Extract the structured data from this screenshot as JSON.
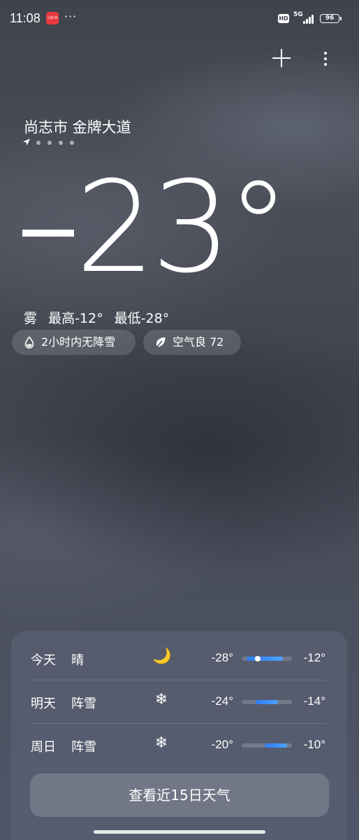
{
  "status_bar": {
    "time": "11:08",
    "app_badge_text": "小红书",
    "more": "···",
    "hd": "HD",
    "network": "5G",
    "battery": "96"
  },
  "location": {
    "name": "尚志市 金牌大道",
    "page_count": 5,
    "current_page": 1
  },
  "current": {
    "temperature": "23°",
    "temperature_value": -23,
    "condition": "雾",
    "high": "最高-12°",
    "low": "最低-28°"
  },
  "chips": {
    "precip": "2小时内无降雪",
    "air": "空气良 72"
  },
  "forecast": [
    {
      "day": "今天",
      "condition": "晴",
      "icon": "moon-icon",
      "glyph": "🌙",
      "low": "-28°",
      "high": "-12°",
      "low_v": -28,
      "high_v": -12,
      "current_v": -23
    },
    {
      "day": "明天",
      "condition": "阵雪",
      "icon": "snowflake-icon",
      "glyph": "❄",
      "low": "-24°",
      "high": "-14°",
      "low_v": -24,
      "high_v": -14
    },
    {
      "day": "周日",
      "condition": "阵雪",
      "icon": "snowflake-icon",
      "glyph": "❄",
      "low": "-20°",
      "high": "-10°",
      "low_v": -20,
      "high_v": -10
    }
  ],
  "forecast_range": {
    "min": -30,
    "max": -8
  },
  "forecast_button": "查看近15日天气",
  "colors": {
    "accent": "#2f7cf0",
    "bar_light": "#4aa3ff"
  }
}
